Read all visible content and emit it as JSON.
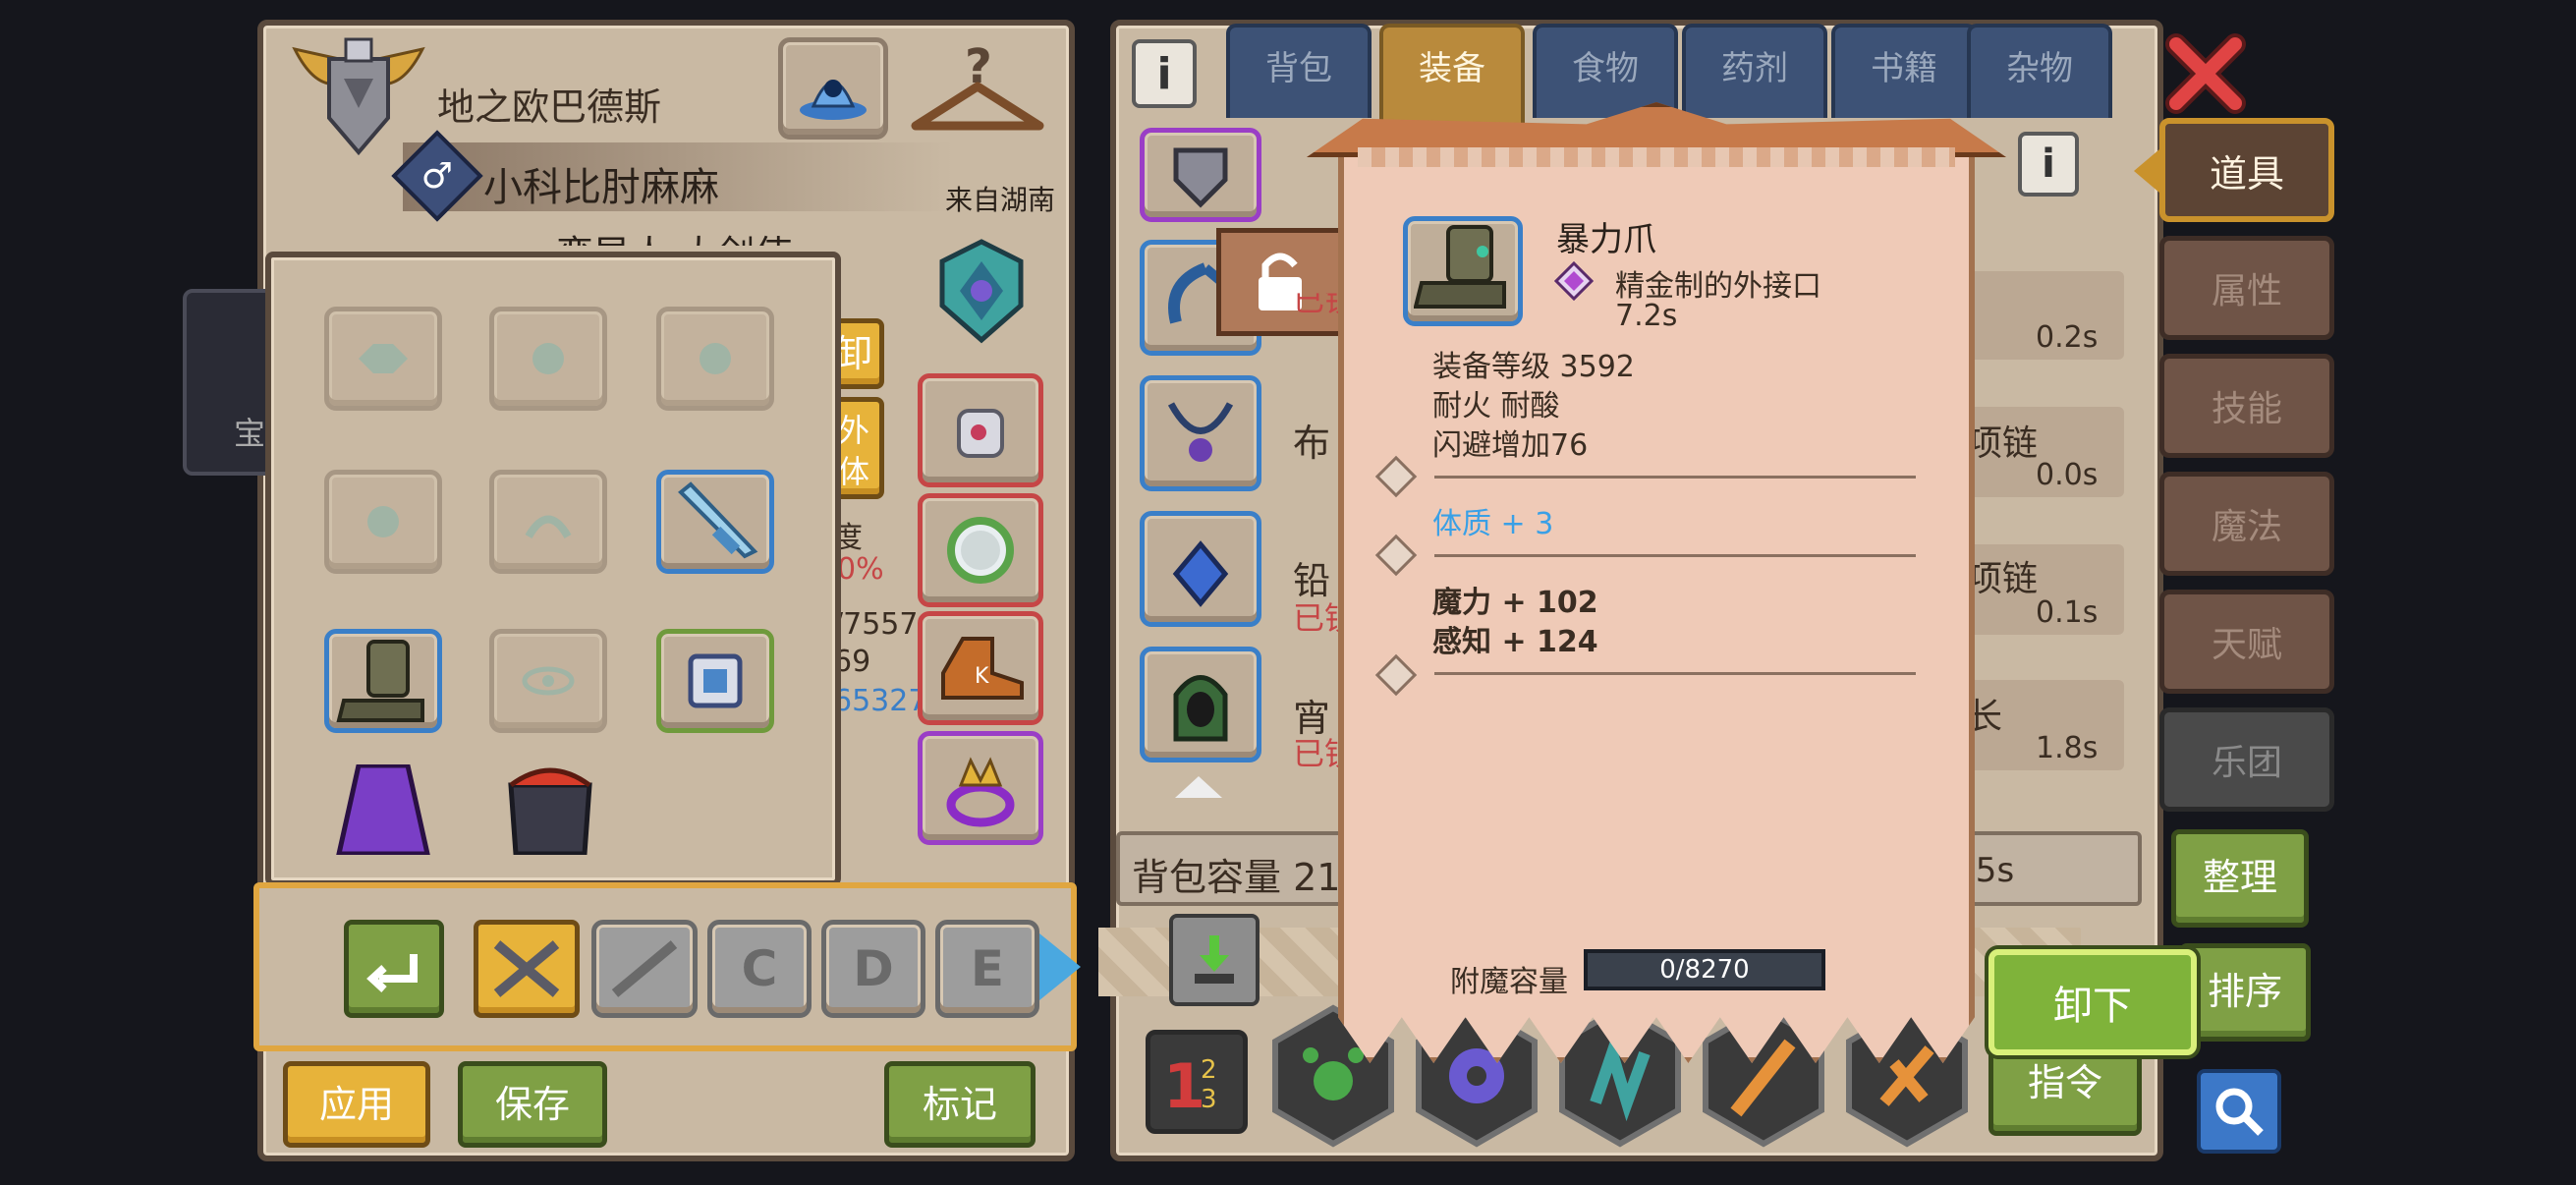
{
  "character": {
    "title": "地之欧巴德斯",
    "name": "小科比肘麻麻",
    "origin": "来自湖南",
    "subtitle_partial": "蛮导人 大剑使",
    "gender_icon": "male-symbol-icon"
  },
  "left_partial": {
    "unequip_label": "卸",
    "external_label_line1": "外",
    "external_label_line2": "体",
    "degree_label": "度",
    "percent_value": "0%",
    "hp_value": "/7557",
    "num_value": "69",
    "gold_value": "65327",
    "side_label": "宝"
  },
  "loadout_bar": {
    "slots": [
      "C",
      "D",
      "E"
    ]
  },
  "bottom_buttons": {
    "apply": "应用",
    "save": "保存",
    "mark": "标记"
  },
  "inventory": {
    "tabs": [
      {
        "label": "背包",
        "active": false
      },
      {
        "label": "装备",
        "active": true
      },
      {
        "label": "食物",
        "active": false
      },
      {
        "label": "药剂",
        "active": false
      },
      {
        "label": "书籍",
        "active": false
      },
      {
        "label": "杂物",
        "active": false
      }
    ],
    "rows": [
      {
        "name_partial": "",
        "status": "已锁",
        "time": "0.2s",
        "right_partial": "",
        "status_visible": true
      },
      {
        "name_partial": "布",
        "status": "",
        "time": "0.0s",
        "right_partial": "项链"
      },
      {
        "name_partial": "铅",
        "status": "已锁",
        "time": "0.1s",
        "right_partial": "项链"
      },
      {
        "name_partial": "宵",
        "status": "已锁",
        "time": "1.8s",
        "right_partial": "长"
      }
    ],
    "capacity_label": "背包容量 21",
    "capacity_time": ".5s"
  },
  "side_tabs": [
    "道具",
    "属性",
    "技能",
    "魔法",
    "天赋",
    "乐团"
  ],
  "right_buttons": {
    "organize": "整理",
    "sort": "排序",
    "command": "指令"
  },
  "tooltip": {
    "item_name": "暴力爪",
    "gem_name": "精金制的外接口",
    "gem_time": "7.2s",
    "equip_level": "装备等级 3592",
    "traits": "耐火 耐酸",
    "dodge": "闪避增加76",
    "stat_blue": "体质 + 3",
    "stat_magic": "魔力 + 102",
    "stat_perception": "感知 + 124",
    "enchant_label": "附魔容量",
    "enchant_value": "0/8270",
    "enchant_fraction": 0.0
  },
  "unequip_button": "卸下",
  "colors": {
    "panel_bg": "#c9b9a3",
    "tab_blue": "#3d5276",
    "tab_active": "#b98a3c",
    "tooltip_bg": "#efcab7",
    "stat_blue": "#3aa0e6",
    "button_green": "#7fa045",
    "button_yellow": "#e7b33a",
    "close_red": "#d23c3c"
  }
}
